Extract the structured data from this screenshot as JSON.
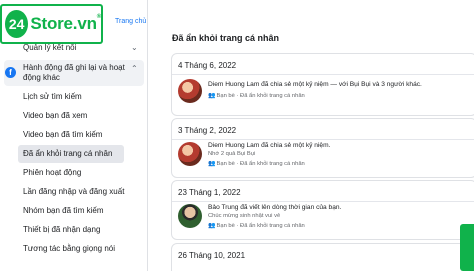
{
  "logo": {
    "badge": "24",
    "text": "Store.vn",
    "reg": "®"
  },
  "top_link": "Trang chủ",
  "sidebar": {
    "items": [
      {
        "label": "Quản lý kết nối"
      },
      {
        "label": "Hành động đã ghi lại và hoạt",
        "label2": "động khác"
      },
      {
        "label": "Lịch sử tìm kiếm"
      },
      {
        "label": "Video bạn đã xem"
      },
      {
        "label": "Video bạn đã tìm kiếm"
      },
      {
        "label": "Đã ẩn khỏi trang cá nhân"
      },
      {
        "label": "Phiên hoạt động"
      },
      {
        "label": "Lần đăng nhập và đăng xuất"
      },
      {
        "label": "Nhóm bạn đã tìm kiếm"
      },
      {
        "label": "Thiết bị đã nhận dạng"
      },
      {
        "label": "Tương tác bằng giọng nói"
      }
    ]
  },
  "main": {
    "title": "Đã ẩn khỏi trang cá nhân",
    "cards": [
      {
        "date": "4 Tháng 6, 2022",
        "entry_title": "Diem Huong Lam đã chia sẻ một kỷ niệm — với Bụi Bụi và 3 người khác.",
        "entry_sub": "",
        "meta": "Bạn bè · Đã ẩn khỏi trang cá nhân"
      },
      {
        "date": "3 Tháng 2, 2022",
        "entry_title": "Diem Huong Lam đã chia sẻ một kỷ niệm.",
        "entry_sub": "Nhớ 2 quả Bụi Bụi",
        "meta": "Bạn bè · Đã ẩn khỏi trang cá nhân"
      },
      {
        "date": "23 Tháng 1, 2022",
        "entry_title": "Bảo Trung đã viết lên dòng thời gian của bạn.",
        "entry_sub": "Chúc mừng sinh nhật vui vẻ",
        "meta": "Bạn bè · Đã ẩn khỏi trang cá nhân"
      },
      {
        "date": "26 Tháng 10, 2021"
      }
    ]
  },
  "colors": {
    "accent": "#1877f2",
    "brand_green": "#10b24b",
    "background": "#d9dde3"
  }
}
